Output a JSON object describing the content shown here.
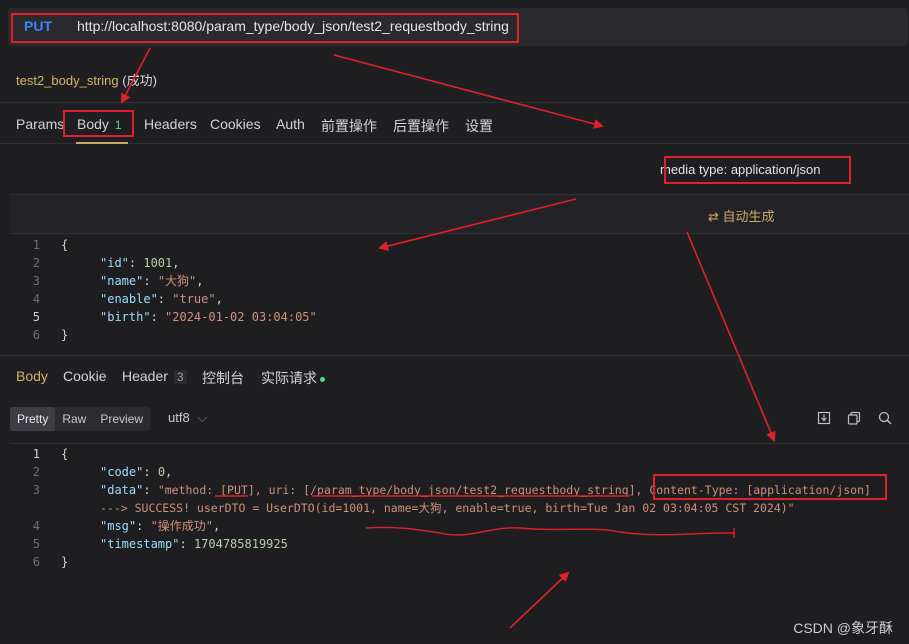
{
  "request": {
    "method": "PUT",
    "url": "http://localhost:8080/param_type/body_json/test2_requestbody_string",
    "api_name": "test2_body_string",
    "status": "(成功)"
  },
  "request_tabs": [
    {
      "label": "Params"
    },
    {
      "label": "Body",
      "badge": "1"
    },
    {
      "label": "Headers"
    },
    {
      "label": "Cookies"
    },
    {
      "label": "Auth"
    },
    {
      "label": "前置操作"
    },
    {
      "label": "后置操作"
    },
    {
      "label": "设置"
    }
  ],
  "media_type": "media type: application/json",
  "auto_generate": "自动生成",
  "request_body": {
    "line_numbers": [
      "1",
      "2",
      "3",
      "4",
      "5",
      "6"
    ],
    "l1": "{",
    "id_key": "\"id\"",
    "id_val": "1001",
    "name_key": "\"name\"",
    "name_val": "\"大狗\"",
    "enable_key": "\"enable\"",
    "enable_val": "\"true\"",
    "birth_key": "\"birth\"",
    "birth_val": "\"2024-01-02 03:04:05\"",
    "l6": "}"
  },
  "response_tabs": [
    {
      "label": "Body"
    },
    {
      "label": "Cookie"
    },
    {
      "label": "Header",
      "badge": "3"
    },
    {
      "label": "控制台"
    },
    {
      "label": "实际请求"
    }
  ],
  "format_buttons": [
    "Pretty",
    "Raw",
    "Preview"
  ],
  "encoding": "utf8",
  "response_body": {
    "l1": "{",
    "code_key": "\"code\"",
    "code_val": "0",
    "data_key": "\"data\"",
    "data_val_1": "\"method: [PUT], uri: [/param_type/body_json/test2_requestbody_string], Content-Type: [application/json]",
    "data_val_2": "---> SUCCESS! userDTO = UserDTO(id=1001, name=大狗, enable=true, birth=Tue Jan 02 03:04:05 CST 2024)\"",
    "msg_key": "\"msg\"",
    "msg_val": "\"操作成功\"",
    "ts_key": "\"timestamp\"",
    "ts_val": "1704785819925",
    "l6": "}"
  },
  "watermark": "CSDN @象牙酥",
  "icons": [
    "download-icon",
    "copy-icon",
    "search-icon",
    "refresh-icon",
    "chevron-down-icon"
  ],
  "colors": {
    "annotation": "#e0202a",
    "method": "#3b82f6",
    "active_tab": "#c9a96a"
  }
}
